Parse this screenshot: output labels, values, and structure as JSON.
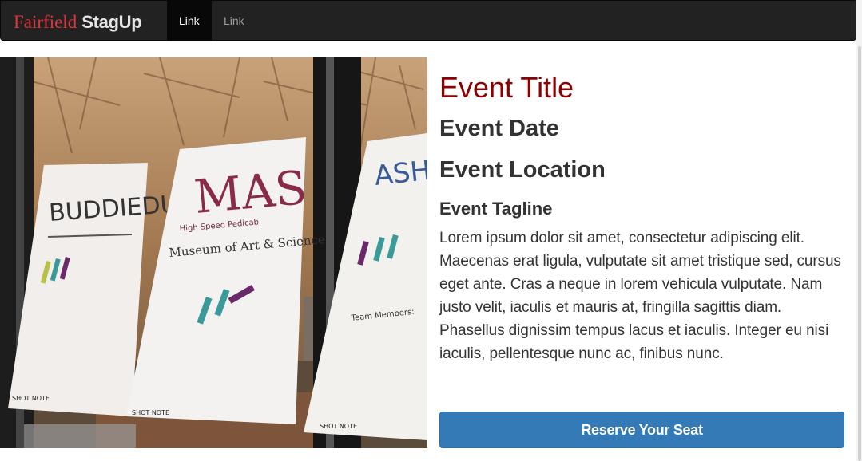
{
  "navbar": {
    "brand_part1": "Fairfield",
    "brand_part2": "StagUp",
    "links": [
      "Link",
      "Link"
    ]
  },
  "event": {
    "title": "Event Title",
    "date": "Event Date",
    "location": "Event Location",
    "tagline": "Event Tagline",
    "description": "Lorem ipsum dolor sit amet, consectetur adipiscing elit. Maecenas erat ligula, vulputate sit amet tristique sed, cursus eget ante. Cras a neque in lorem vehicula vulputate. Nam justo velit, iaculis et mauris at, fringilla sagittis diam. Phasellus dignissim tempus lacus et iaculis. Integer eu nisi iaculis, pellentesque nunc ac, finibus nunc."
  },
  "photo": {
    "alt_content": "posters on window",
    "poster_texts": [
      "BUDDIEDUP",
      "MAS",
      "High Speed Pedicab",
      "Museum of Art & Science",
      "ASHV",
      "SHOT NOTE",
      "SHOT NOTE",
      "SHOT NOTE",
      "Team Members:"
    ]
  },
  "cta": {
    "label": "Reserve Your Seat"
  },
  "colors": {
    "navbar_bg": "#222222",
    "brand_red": "#e0333a",
    "title_red": "#8b0000",
    "button_blue": "#337ab7"
  }
}
